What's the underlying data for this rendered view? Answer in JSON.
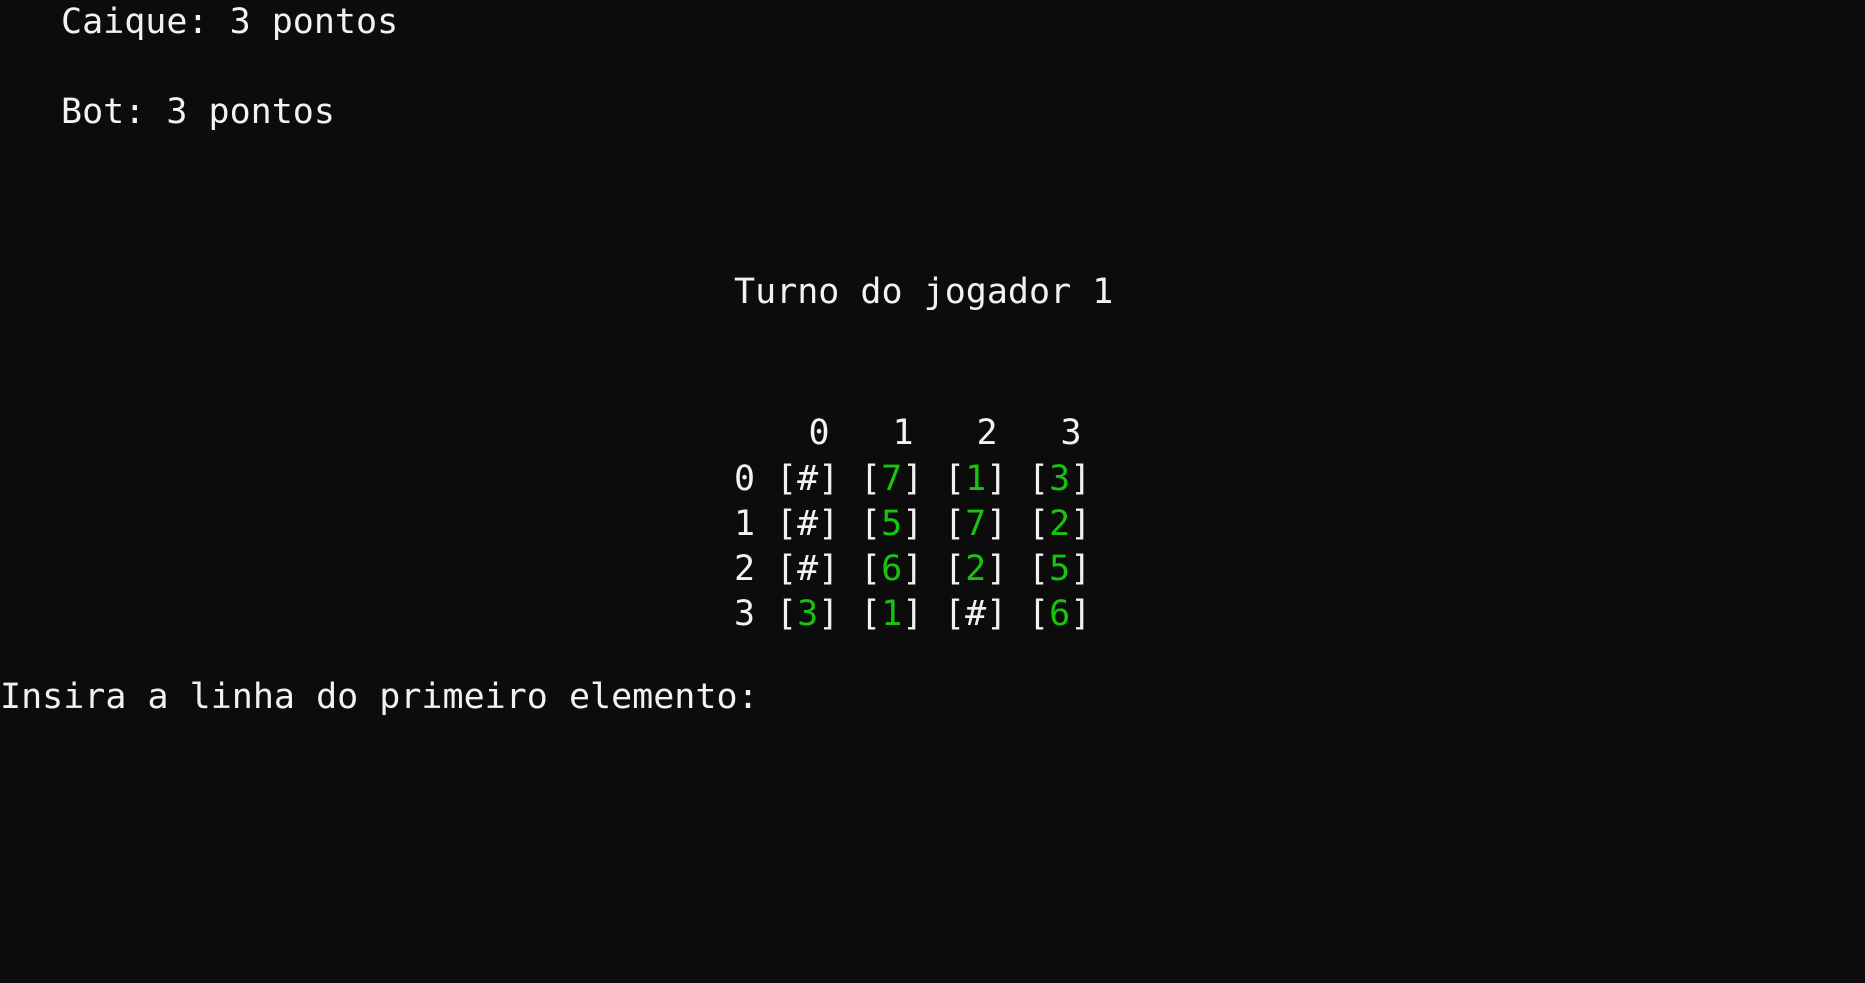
{
  "scoreboard": {
    "player": "Caique: 3 pontos",
    "bot": "Bot: 3 pontos"
  },
  "turn_text": "Turno do jogador 1",
  "board": {
    "column_labels": [
      "0",
      "1",
      "2",
      "3"
    ],
    "rows": [
      {
        "label": "0",
        "cells": [
          "#",
          "7",
          "1",
          "3"
        ]
      },
      {
        "label": "1",
        "cells": [
          "#",
          "5",
          "7",
          "2"
        ]
      },
      {
        "label": "2",
        "cells": [
          "#",
          "6",
          "2",
          "5"
        ]
      },
      {
        "label": "3",
        "cells": [
          "3",
          "1",
          "#",
          "6"
        ]
      }
    ]
  },
  "prompt": "Insira a linha do primeiro elemento:",
  "colors": {
    "background": "#0c0c0c",
    "text": "#f2f2f2",
    "revealed_value": "#16c60c"
  }
}
